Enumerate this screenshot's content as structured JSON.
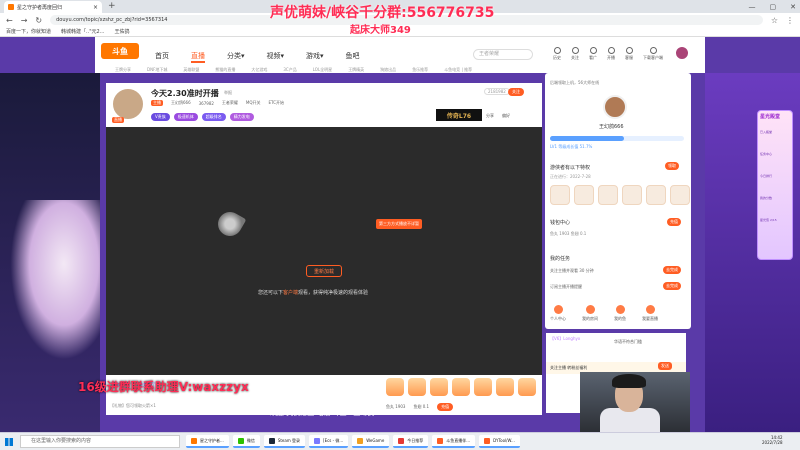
{
  "browser": {
    "tab_title": "星之守护者再度回归",
    "url": "douyu.com/topic/xzshz_pc_zbj?rid=3567314",
    "bookmarks": [
      "百度一下，你就知道",
      "韩城韩建「..\"元2...",
      "王佑鸽"
    ]
  },
  "overlay": {
    "title": "声优萌妹/峡谷千分群:556776735",
    "subtitle": "起床大师349",
    "bottom": "16级进群联系助理V:waxzzyx"
  },
  "site": {
    "logo": "斗鱼",
    "nav": [
      "首页",
      "直播",
      "分类▾",
      "视频▾",
      "游戏▾",
      "鱼吧"
    ],
    "search_placeholder": "王者荣耀",
    "header_icons": [
      "历史",
      "关注",
      "看广",
      "开播",
      "客服",
      "下载客户端"
    ],
    "subnav": [
      "王牌分享",
      "DNF地下城",
      "英雄联盟",
      "熊猫的直播",
      "大亿游戏",
      "3C产品",
      "LOL全明星",
      "王牌精英",
      "狗娘出品",
      "鱼乐推荐",
      "斗鱼电竞 | 推荐"
    ]
  },
  "room": {
    "title": "今天2.30准时开播",
    "tag": "举报",
    "streamer": "王幻鸽666",
    "fans": "367982",
    "level_badge": "主播",
    "category": "王者荣耀",
    "meta": [
      "MQ开关",
      "ETC开始",
      "分享"
    ],
    "badges": [
      "V贵族",
      "极速机体",
      "超级排名",
      "精力发电"
    ],
    "hot": "2181982",
    "follow_label": "关注",
    "live_label": "直播",
    "banner_text": "传奇L76",
    "share_label": "分享",
    "report_label": "偏好"
  },
  "player": {
    "tip": "第三方方式播放不详暂",
    "reload_label": "重新加载",
    "hint_prefix": "您还可以下",
    "hint_link": "客户端",
    "hint_suffix": "观看，获得纯净极速的观看体验"
  },
  "giftbar": {
    "left_buttons": [
      "贵族开通",
      "鱼丸大厅"
    ],
    "bottom_text": "【礼物】您可领取火箭×1",
    "account": [
      "鱼丸 1903",
      "鱼翅 0.1"
    ],
    "recharge_label": "充值"
  },
  "rpanel": {
    "title": "后端领取上机，56大师在线",
    "name": "王幻鸽666",
    "level_text": "LV1 等级成长值 51.7%",
    "level_progress": 0.55,
    "task_title": "游侠者有以下特权",
    "task_sub": "正在进行：2022-7-28",
    "task_btn": "领取",
    "wallet_title": "钱包中心",
    "wallet_sub": "鱼丸 1903   鱼翅 0.1",
    "wallet_btn": "充值",
    "mytask_title": "我的任务",
    "mytask_1": "关注主播并观看 30 分钟",
    "mytask_2": "订阅主播开播提醒",
    "task_btn_1": "去完成",
    "task_btn_2": "去完成",
    "bottom": [
      "个人中心",
      "我的房间",
      "我的鱼",
      "我要直播"
    ]
  },
  "chat": {
    "top": "【V6】Longhyx",
    "line": "华语不符合门槛",
    "row": "关注主播  转粉丝福利",
    "send": "发送"
  },
  "promo": {
    "title": "星光殿堂",
    "items": [
      "已入殿堂",
      "任务中心",
      "今日排行",
      "我的分数",
      "星光值 2/15"
    ]
  },
  "bottom_strip": "欢迎   文鹤尼亚 电信 斗鱼 · 王幻鸽NB",
  "taskbar": {
    "search": "在这里输入你要搜索的内容",
    "apps": [
      "星之守护者...",
      "微信",
      "Steam 登录",
      "[Ecs - 微...",
      "WeGame",
      "今日推荐",
      "斗鱼直播伴...",
      "DYTool/W..."
    ],
    "time": "14:42",
    "date": "2022/7/28"
  },
  "colors": {
    "accent": "#ff5d23",
    "overlay_text": "#ff2d55",
    "brand_purple": "#6b3cc0"
  }
}
